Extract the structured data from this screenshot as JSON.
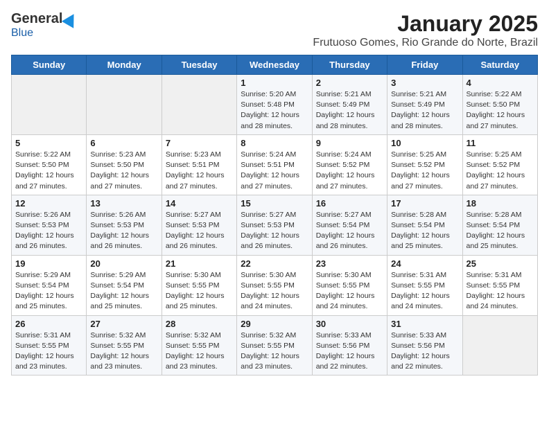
{
  "logo": {
    "general": "General",
    "blue": "Blue"
  },
  "title": "January 2025",
  "subtitle": "Frutuoso Gomes, Rio Grande do Norte, Brazil",
  "days_of_week": [
    "Sunday",
    "Monday",
    "Tuesday",
    "Wednesday",
    "Thursday",
    "Friday",
    "Saturday"
  ],
  "weeks": [
    [
      {
        "day": "",
        "info": ""
      },
      {
        "day": "",
        "info": ""
      },
      {
        "day": "",
        "info": ""
      },
      {
        "day": "1",
        "info": "Sunrise: 5:20 AM\nSunset: 5:48 PM\nDaylight: 12 hours\nand 28 minutes."
      },
      {
        "day": "2",
        "info": "Sunrise: 5:21 AM\nSunset: 5:49 PM\nDaylight: 12 hours\nand 28 minutes."
      },
      {
        "day": "3",
        "info": "Sunrise: 5:21 AM\nSunset: 5:49 PM\nDaylight: 12 hours\nand 28 minutes."
      },
      {
        "day": "4",
        "info": "Sunrise: 5:22 AM\nSunset: 5:50 PM\nDaylight: 12 hours\nand 27 minutes."
      }
    ],
    [
      {
        "day": "5",
        "info": "Sunrise: 5:22 AM\nSunset: 5:50 PM\nDaylight: 12 hours\nand 27 minutes."
      },
      {
        "day": "6",
        "info": "Sunrise: 5:23 AM\nSunset: 5:50 PM\nDaylight: 12 hours\nand 27 minutes."
      },
      {
        "day": "7",
        "info": "Sunrise: 5:23 AM\nSunset: 5:51 PM\nDaylight: 12 hours\nand 27 minutes."
      },
      {
        "day": "8",
        "info": "Sunrise: 5:24 AM\nSunset: 5:51 PM\nDaylight: 12 hours\nand 27 minutes."
      },
      {
        "day": "9",
        "info": "Sunrise: 5:24 AM\nSunset: 5:52 PM\nDaylight: 12 hours\nand 27 minutes."
      },
      {
        "day": "10",
        "info": "Sunrise: 5:25 AM\nSunset: 5:52 PM\nDaylight: 12 hours\nand 27 minutes."
      },
      {
        "day": "11",
        "info": "Sunrise: 5:25 AM\nSunset: 5:52 PM\nDaylight: 12 hours\nand 27 minutes."
      }
    ],
    [
      {
        "day": "12",
        "info": "Sunrise: 5:26 AM\nSunset: 5:53 PM\nDaylight: 12 hours\nand 26 minutes."
      },
      {
        "day": "13",
        "info": "Sunrise: 5:26 AM\nSunset: 5:53 PM\nDaylight: 12 hours\nand 26 minutes."
      },
      {
        "day": "14",
        "info": "Sunrise: 5:27 AM\nSunset: 5:53 PM\nDaylight: 12 hours\nand 26 minutes."
      },
      {
        "day": "15",
        "info": "Sunrise: 5:27 AM\nSunset: 5:53 PM\nDaylight: 12 hours\nand 26 minutes."
      },
      {
        "day": "16",
        "info": "Sunrise: 5:27 AM\nSunset: 5:54 PM\nDaylight: 12 hours\nand 26 minutes."
      },
      {
        "day": "17",
        "info": "Sunrise: 5:28 AM\nSunset: 5:54 PM\nDaylight: 12 hours\nand 25 minutes."
      },
      {
        "day": "18",
        "info": "Sunrise: 5:28 AM\nSunset: 5:54 PM\nDaylight: 12 hours\nand 25 minutes."
      }
    ],
    [
      {
        "day": "19",
        "info": "Sunrise: 5:29 AM\nSunset: 5:54 PM\nDaylight: 12 hours\nand 25 minutes."
      },
      {
        "day": "20",
        "info": "Sunrise: 5:29 AM\nSunset: 5:54 PM\nDaylight: 12 hours\nand 25 minutes."
      },
      {
        "day": "21",
        "info": "Sunrise: 5:30 AM\nSunset: 5:55 PM\nDaylight: 12 hours\nand 25 minutes."
      },
      {
        "day": "22",
        "info": "Sunrise: 5:30 AM\nSunset: 5:55 PM\nDaylight: 12 hours\nand 24 minutes."
      },
      {
        "day": "23",
        "info": "Sunrise: 5:30 AM\nSunset: 5:55 PM\nDaylight: 12 hours\nand 24 minutes."
      },
      {
        "day": "24",
        "info": "Sunrise: 5:31 AM\nSunset: 5:55 PM\nDaylight: 12 hours\nand 24 minutes."
      },
      {
        "day": "25",
        "info": "Sunrise: 5:31 AM\nSunset: 5:55 PM\nDaylight: 12 hours\nand 24 minutes."
      }
    ],
    [
      {
        "day": "26",
        "info": "Sunrise: 5:31 AM\nSunset: 5:55 PM\nDaylight: 12 hours\nand 23 minutes."
      },
      {
        "day": "27",
        "info": "Sunrise: 5:32 AM\nSunset: 5:55 PM\nDaylight: 12 hours\nand 23 minutes."
      },
      {
        "day": "28",
        "info": "Sunrise: 5:32 AM\nSunset: 5:55 PM\nDaylight: 12 hours\nand 23 minutes."
      },
      {
        "day": "29",
        "info": "Sunrise: 5:32 AM\nSunset: 5:55 PM\nDaylight: 12 hours\nand 23 minutes."
      },
      {
        "day": "30",
        "info": "Sunrise: 5:33 AM\nSunset: 5:56 PM\nDaylight: 12 hours\nand 22 minutes."
      },
      {
        "day": "31",
        "info": "Sunrise: 5:33 AM\nSunset: 5:56 PM\nDaylight: 12 hours\nand 22 minutes."
      },
      {
        "day": "",
        "info": ""
      }
    ]
  ]
}
